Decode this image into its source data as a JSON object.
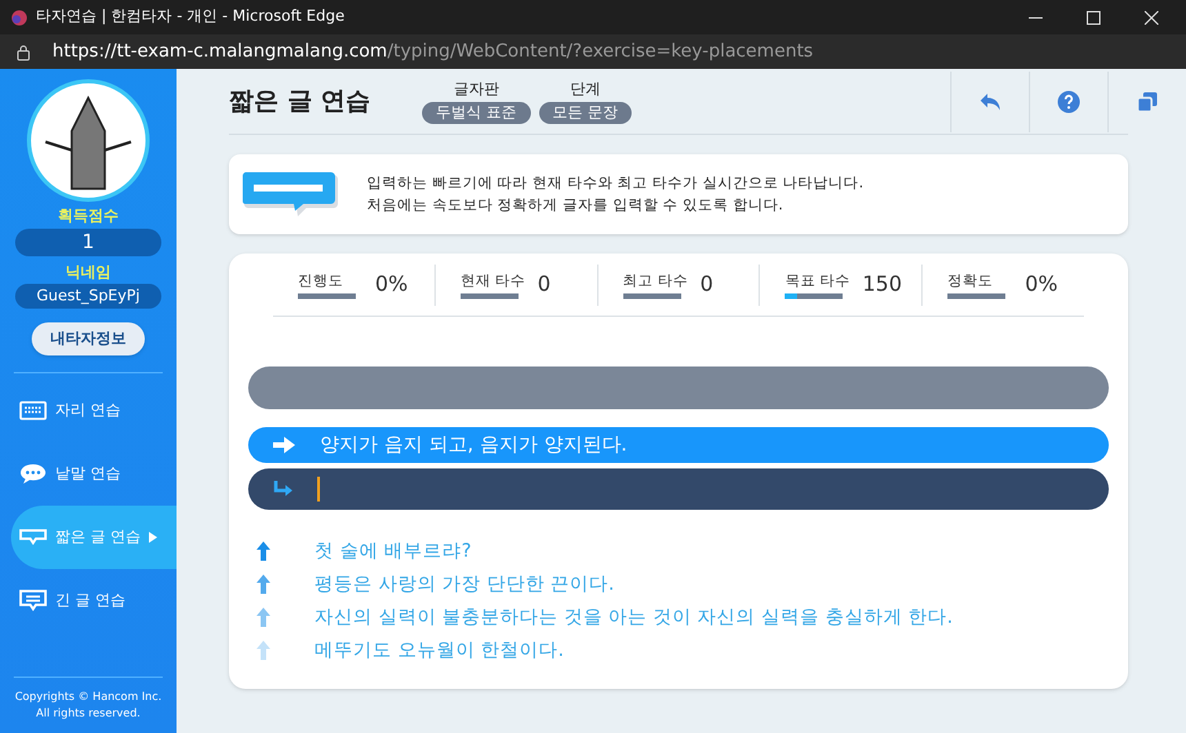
{
  "window": {
    "title": "타자연습 | 한컴타자 - 개인 - Microsoft Edge",
    "url_host": "https://tt-exam-c.malangmalang.com",
    "url_path": "/typing/WebContent/?exercise=key-placements"
  },
  "sidebar": {
    "score_label": "획득점수",
    "score": "1",
    "nickname_label": "닉네임",
    "nickname": "Guest_SpEyPj",
    "profile_button": "내타자정보",
    "items": [
      {
        "label": "자리 연습",
        "kind": "keyboard",
        "selected": false
      },
      {
        "label": "낱말 연습",
        "kind": "speech",
        "selected": false
      },
      {
        "label": "짧은 글 연습",
        "kind": "short",
        "selected": true
      },
      {
        "label": "긴 글 연습",
        "kind": "long",
        "selected": false
      }
    ],
    "copyright": [
      "Copyrights © Hancom Inc.",
      "All rights reserved."
    ]
  },
  "header": {
    "title": "짧은 글 연습",
    "layout_label": "글자판",
    "layout": "두벌식 표준",
    "level_label": "단계",
    "level": "모든 문장"
  },
  "info": [
    "입력하는 빠르기에 따라 현재 타수와 최고 타수가 실시간으로 나타납니다.",
    "처음에는 속도보다 정확하게 글자를 입력할 수 있도록 합니다."
  ],
  "stats": [
    {
      "label": "진행도",
      "value": "0%"
    },
    {
      "label": "현재 타수",
      "value": "0"
    },
    {
      "label": "최고 타수",
      "value": "0"
    },
    {
      "label": "목표 타수",
      "value": "150",
      "level": 0.2
    },
    {
      "label": "정확도",
      "value": "0%"
    }
  ],
  "current_sentence": "양지가 음지 되고, 음지가 양지된다.",
  "upcoming": [
    "첫 술에 배부르랴?",
    "평등은 사랑의 가장 단단한 끈이다.",
    "자신의 실력이 불충분하다는 것을 아는 것이 자신의 실력을 충실하게 한다.",
    "메뚜기도 오뉴월이 한철이다."
  ]
}
